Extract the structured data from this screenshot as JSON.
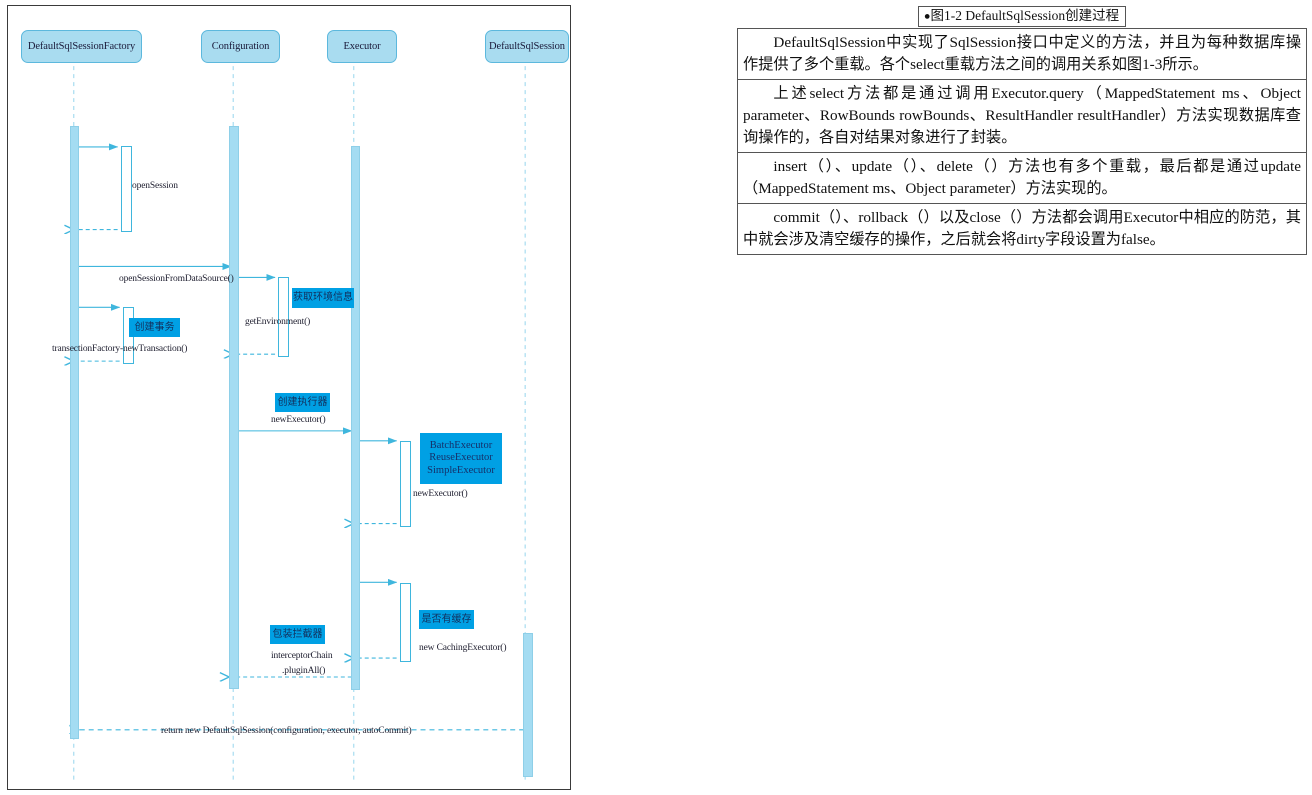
{
  "diagram": {
    "type": "uml-sequence-diagram",
    "title": "DefaultSqlSession creation sequence",
    "colors": {
      "actor_fill": "#a9dcf0",
      "actor_border": "#5cb8dd",
      "activation_fill": "#a4dcf2",
      "lifeline": "#8ecfe8",
      "arrow": "#3fb6dd",
      "note_fill": "#00a0e4",
      "note_text": "#12305e"
    },
    "participants": [
      {
        "id": "factory",
        "label": "DefaultSqlSessionFactory"
      },
      {
        "id": "configuration",
        "label": "Configuration"
      },
      {
        "id": "executor",
        "label": "Executor"
      },
      {
        "id": "session",
        "label": "DefaultSqlSession"
      }
    ],
    "messages": [
      {
        "id": "m1",
        "label": "openSession"
      },
      {
        "id": "m2",
        "label": "openSessionFromDataSource()"
      },
      {
        "id": "m3",
        "label": "transectionFactory-newTransaction()"
      },
      {
        "id": "m4",
        "label": "getEnvironment()"
      },
      {
        "id": "m5",
        "label": "newExecutor()"
      },
      {
        "id": "m6",
        "label": "newExecutor()"
      },
      {
        "id": "m7",
        "label": "new CachingExecutor()"
      },
      {
        "id": "m8",
        "label": "interceptorChain"
      },
      {
        "id": "m8b",
        "label": ".pluginAll()"
      },
      {
        "id": "m9",
        "label": "return new DefaultSqlSession(configuration, executor, autoCommit)"
      }
    ],
    "notes": [
      {
        "id": "n1",
        "label": "获取环境信息"
      },
      {
        "id": "n2",
        "label": "创建事务"
      },
      {
        "id": "n3",
        "label": "创建执行器"
      },
      {
        "id": "n4l1",
        "label": "BatchExecutor"
      },
      {
        "id": "n4l2",
        "label": "ReuseExecutor"
      },
      {
        "id": "n4l3",
        "label": "SimpleExecutor"
      },
      {
        "id": "n5",
        "label": "是否有缓存"
      },
      {
        "id": "n6",
        "label": "包装拦截器"
      }
    ]
  },
  "text_panel": {
    "caption": {
      "bullet": "●",
      "text": "图1-2 DefaultSqlSession创建过程"
    },
    "paragraphs": [
      "DefaultSqlSession中实现了SqlSession接口中定义的方法，并且为每种数据库操作提供了多个重载。各个select重载方法之间的调用关系如图1-3所示。",
      "上述select方法都是通过调用Executor.query（MappedStatement ms、Object parameter、RowBounds rowBounds、ResultHandler resultHandler）方法实现数据库查询操作的，各自对结果对象进行了封装。",
      "insert（）、update（）、delete（）方法也有多个重载，最后都是通过update（MappedStatement ms、Object parameter）方法实现的。",
      "commit（）、rollback（）以及close（）方法都会调用Executor中相应的防范，其中就会涉及清空缓存的操作，之后就会将dirty字段设置为false。"
    ]
  }
}
